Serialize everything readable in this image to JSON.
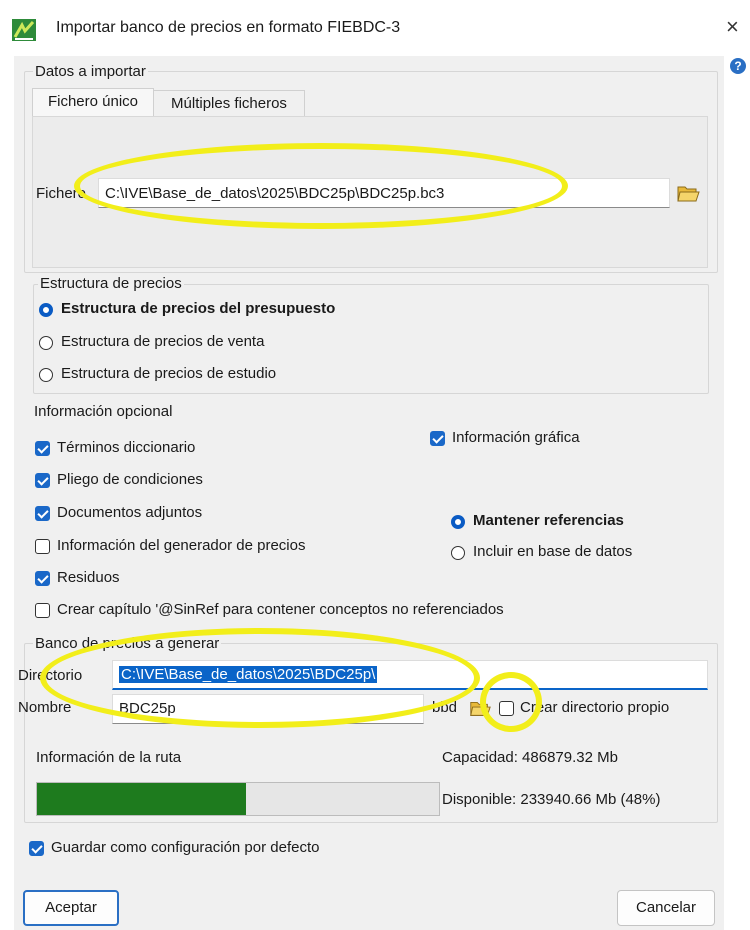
{
  "window": {
    "title": "Importar banco de precios en formato FIEBDC-3",
    "close_glyph": "×",
    "help_glyph": "?"
  },
  "datos": {
    "legend": "Datos a importar",
    "tabs": [
      {
        "label": "Fichero único",
        "active": true
      },
      {
        "label": "Múltiples ficheros",
        "active": false
      }
    ],
    "file_label": "Fichero",
    "file_value": "C:\\IVE\\Base_de_datos\\2025\\BDC25p\\BDC25p.bc3"
  },
  "estructura": {
    "legend": "Estructura de precios",
    "options": [
      {
        "label": "Estructura de precios del presupuesto",
        "selected": true
      },
      {
        "label": "Estructura de precios de venta",
        "selected": false
      },
      {
        "label": "Estructura de precios de estudio",
        "selected": false
      }
    ]
  },
  "opcional": {
    "legend": "Información opcional",
    "terminos": {
      "label": "Términos diccionario",
      "checked": true
    },
    "pliego": {
      "label": "Pliego de condiciones",
      "checked": true
    },
    "documentos": {
      "label": "Documentos adjuntos",
      "checked": true
    },
    "generador": {
      "label": "Información del generador de precios",
      "checked": false
    },
    "residuos": {
      "label": "Residuos",
      "checked": true
    },
    "sinref": {
      "label": "Crear capítulo '@SinRef para contener conceptos no referenciados",
      "checked": false
    },
    "grafica": {
      "label": "Información gráfica",
      "checked": true
    },
    "mantener": {
      "label": "Mantener referencias",
      "selected": true
    },
    "incluir": {
      "label": "Incluir en base de datos",
      "selected": false
    }
  },
  "banco": {
    "legend": "Banco de precios a generar",
    "dir_label": "Directorio",
    "dir_value": "C:\\IVE\\Base_de_datos\\2025\\BDC25p\\",
    "name_label": "Nombre",
    "name_value": "BDC25p",
    "ext_label": "bbd",
    "crear_dir": {
      "label": "Crear directorio propio",
      "checked": false
    },
    "ruta_label": "Información de la ruta",
    "capacidad": "Capacidad: 486879.32 Mb",
    "disponible": "Disponible: 233940.66 Mb (48%)",
    "disk_used_fraction": 0.52
  },
  "footer": {
    "guardar": {
      "label": "Guardar como configuración por defecto",
      "checked": true
    },
    "accept_label": "Aceptar",
    "cancel_label": "Cancelar"
  },
  "colors": {
    "accent": "#1a68c8",
    "progress": "#1e7b1e",
    "highlight_ellipse": "#f2ee1a"
  }
}
